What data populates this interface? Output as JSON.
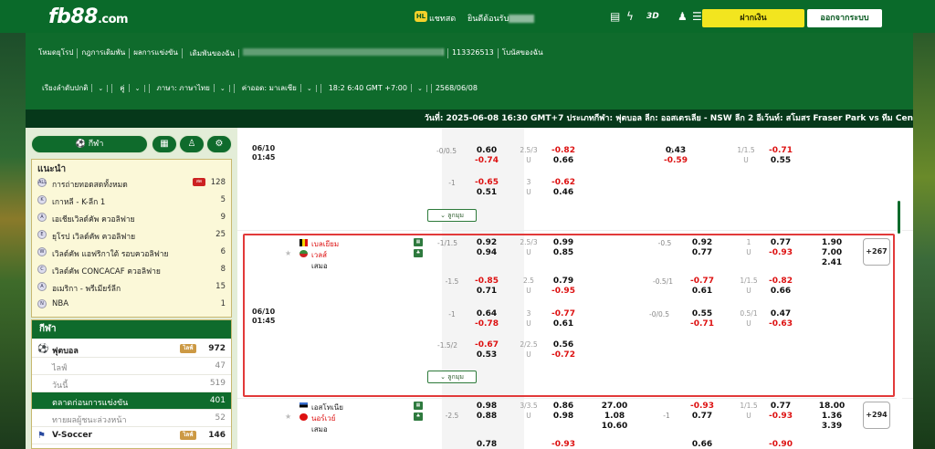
{
  "header": {
    "logo": "fb88",
    "logo_suffix": ".com",
    "chat_badge": "HL",
    "chat_label": "แชทสด",
    "welcome": "ยินดีต้อนรับ",
    "deposit_label": "ฝากเงิน",
    "logout_label": "ออกจากระบบ"
  },
  "nav_top": [
    "โหมดยุโรป",
    "กฎการเดิมพัน",
    "ผลการแข่งขัน",
    "เดิมพันของฉัน",
    "113326513",
    "โบนัสของฉัน"
  ],
  "nav_bottom": [
    {
      "label": "เรียงลำดับปกติ"
    },
    {
      "label": "คู่"
    },
    {
      "label": "ภาษา: ภาษาไทย"
    },
    {
      "label": "ค่าออด: มาเลเซีย"
    },
    {
      "label": "18:2 6:40 GMT +7:00"
    },
    {
      "label": "2568/06/08"
    }
  ],
  "ticker": "วันที่: 2025-06-08 16:30 GMT+7 ประเภทกีฬา: ฟุตบอล ลีก: ออสเตรเลีย - NSW ลีก 2 อีเว้นท์: สโมสร Fraser Park vs ทีม Cen",
  "left": {
    "sport_pill": "กีฬา",
    "recommend_title": "แนะนำ",
    "recommend": [
      {
        "icon": "ALL",
        "name": "การถ่ายทอดสดทั้งหมด",
        "count": "128",
        "live": "สด"
      },
      {
        "icon": "K",
        "name": "เกาหลี - K-ลีก 1",
        "count": "5"
      },
      {
        "icon": "A",
        "name": "เอเชียเวิลด์คัพ ควอลิฟาย",
        "count": "9"
      },
      {
        "icon": "E",
        "name": "ยุโรป เวิลด์คัพ ควอลิฟาย",
        "count": "25"
      },
      {
        "icon": "W",
        "name": "เวิลด์คัพ แอฟริกาใต้ รอบควอลิฟาย",
        "count": "6"
      },
      {
        "icon": "C",
        "name": "เวิลด์คัพ CONCACAF ควอลิฟาย",
        "count": "8"
      },
      {
        "icon": "A",
        "name": "อเมริกา - พรีเมียร์ลีก",
        "count": "15"
      },
      {
        "icon": "N",
        "name": "NBA",
        "count": "1"
      }
    ],
    "sports_title": "กีฬา",
    "sports": [
      {
        "name": "ฟุตบอล",
        "count": "972",
        "live": "ไลฟ์",
        "type": "main"
      },
      {
        "name": "ไลฟ์",
        "count": "47",
        "type": "sub"
      },
      {
        "name": "วันนี้",
        "count": "519",
        "type": "sub"
      },
      {
        "name": "ตลาดก่อนการแข่งขัน",
        "count": "401",
        "type": "active"
      },
      {
        "name": "ทายผลผู้ชนะล่วงหน้า",
        "count": "52",
        "type": "sub"
      },
      {
        "name": "V-Soccer",
        "count": "146",
        "live": "ไลฟ์",
        "type": "main"
      }
    ]
  },
  "matches": {
    "m0": {
      "date": "06/10",
      "time": "01:45",
      "r1": {
        "h1": "-0/0.5",
        "a": "0.60",
        "b": "-0.74",
        "ou1": "2.5/3",
        "ou1u": "U",
        "c": "-0.82",
        "d": "0.66",
        "h2": "0",
        "e": "0.43",
        "f": "-0.59",
        "ou2": "1/1.5",
        "ou2u": "U",
        "g": "-0.71",
        "h": "0.55"
      },
      "r2": {
        "h1": "-1",
        "a": "-0.65",
        "b": "0.51",
        "ou1": "3",
        "ou1u": "U",
        "c": "-0.62",
        "d": "0.46"
      },
      "expander": "ลูกมุม"
    },
    "m1": {
      "home": "เบลเยียม",
      "away": "เวลส์",
      "draw": "เสมอ",
      "date": "06/10",
      "time": "01:45",
      "r1": {
        "h1": "-1/1.5",
        "a": "0.92",
        "b": "0.94",
        "ou1": "2.5/3",
        "ou1u": "U",
        "c": "0.99",
        "d": "0.85",
        "h2": "-0.5",
        "e": "0.92",
        "f": "0.77",
        "ou2": "1",
        "ou2u": "U",
        "g": "0.77",
        "h": "-0.93",
        "x1": "1.90",
        "x2": "7.00",
        "x3": "2.41",
        "more": "+267"
      },
      "r2": {
        "h1": "-1.5",
        "a": "-0.85",
        "b": "0.71",
        "ou1": "2.5",
        "ou1u": "U",
        "c": "0.79",
        "d": "-0.95",
        "h2": "-0.5/1",
        "e": "-0.77",
        "f": "0.61",
        "ou2": "1/1.5",
        "ou2u": "U",
        "g": "-0.82",
        "h": "0.66"
      },
      "r3": {
        "h1": "-1",
        "a": "0.64",
        "b": "-0.78",
        "ou1": "3",
        "ou1u": "U",
        "c": "-0.77",
        "d": "0.61",
        "h2": "-0/0.5",
        "e": "0.55",
        "f": "-0.71",
        "ou2": "0.5/1",
        "ou2u": "U",
        "g": "0.47",
        "h": "-0.63"
      },
      "r4": {
        "h1": "-1.5/2",
        "a": "-0.67",
        "b": "0.53",
        "ou1": "2/2.5",
        "ou1u": "U",
        "c": "0.56",
        "d": "-0.72"
      },
      "expander": "ลูกมุม"
    },
    "m2": {
      "home": "เอสโทเนีย",
      "away": "นอร์เวย์",
      "draw": "เสมอ",
      "r1": {
        "a": "0.98",
        "b": "0.88",
        "ou1": "3/3.5",
        "ou1u": "U",
        "c": "0.86",
        "d": "0.98",
        "h1": "-2.5",
        "x1": "27.00",
        "x2": "1.08",
        "x3": "10.60",
        "h2": "-1",
        "e": "-0.93",
        "f": "0.77",
        "ou2": "1/1.5",
        "ou2u": "U",
        "g": "0.77",
        "h": "-0.93",
        "y1": "18.00",
        "y2": "1.36",
        "y3": "3.39",
        "more": "+294"
      },
      "r2": {
        "a": "0.78",
        "c": "-0.93",
        "e": "0.66",
        "g": "-0.90"
      }
    }
  }
}
